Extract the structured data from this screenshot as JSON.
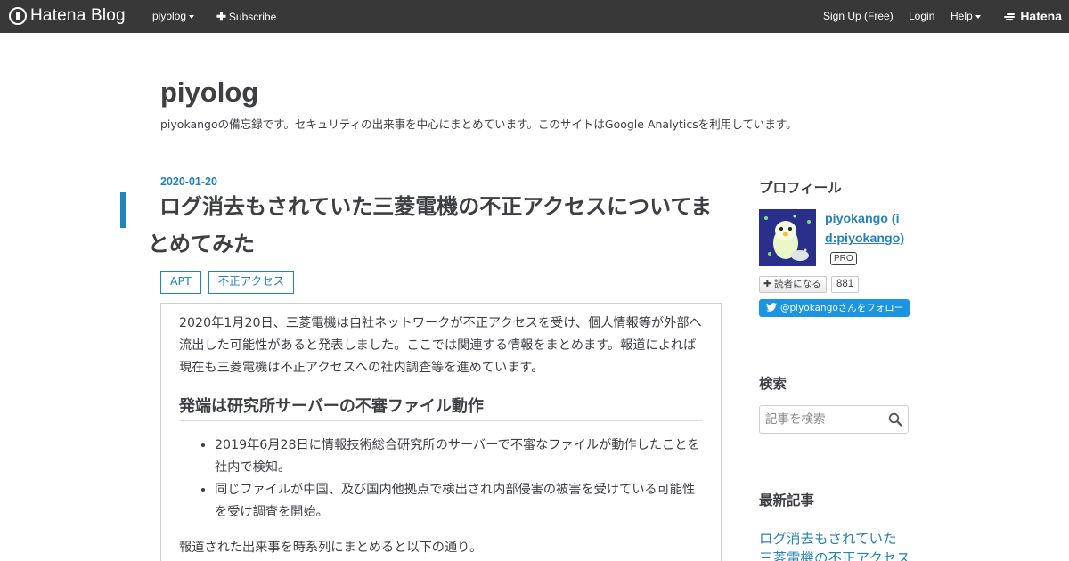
{
  "topbar": {
    "logo_text": "Hatena Blog",
    "blog_menu": "piyolog",
    "subscribe": "Subscribe",
    "signup": "Sign Up (Free)",
    "login": "Login",
    "help": "Help",
    "brand": "Hatena"
  },
  "header": {
    "title": "piyolog",
    "description": "piyokangoの備忘録です。セキュリティの出来事を中心にまとめています。このサイトはGoogle Analyticsを利用しています。"
  },
  "entry": {
    "date": "2020-01-20",
    "title": "ログ消去もされていた三菱電機の不正アクセスについてまとめてみた",
    "tags": [
      "APT",
      "不正アクセス"
    ],
    "intro": "2020年1月20日、三菱電機は自社ネットワークが不正アクセスを受け、個人情報等が外部へ流出した可能性があると発表しました。ここでは関連する情報をまとめます。報道によれば現在も三菱電機は不正アクセスへの社内調査等を進めています。",
    "section_heading": "発端は研究所サーバーの不審ファイル動作",
    "bullets": [
      "2019年6月28日に情報技術総合研究所のサーバーで不審なファイルが動作したことを社内で検知。",
      "同じファイルが中国、及び国内他拠点で検出され内部侵害の被害を受けている可能性を受け調査を開始。"
    ],
    "outro": "報道された出来事を時系列にまとめると以下の通り。"
  },
  "sidebar": {
    "profile_heading": "プロフィール",
    "profile_name": "piyokango (id:piyokango)",
    "pro_badge": "PRO",
    "reader_button": "読者になる",
    "reader_count": "881",
    "twitter_button": "@piyokangoさんをフォロー",
    "search_heading": "検索",
    "search_placeholder": "記事を検索",
    "recent_heading": "最新記事",
    "recent_item": "ログ消去もされていた三菱電機の不正アクセスについてまとめてみた"
  },
  "colors": {
    "topbar": "#383838",
    "accent": "#2583b9",
    "twitter": "#1b95e0",
    "text": "#3d3f44"
  }
}
